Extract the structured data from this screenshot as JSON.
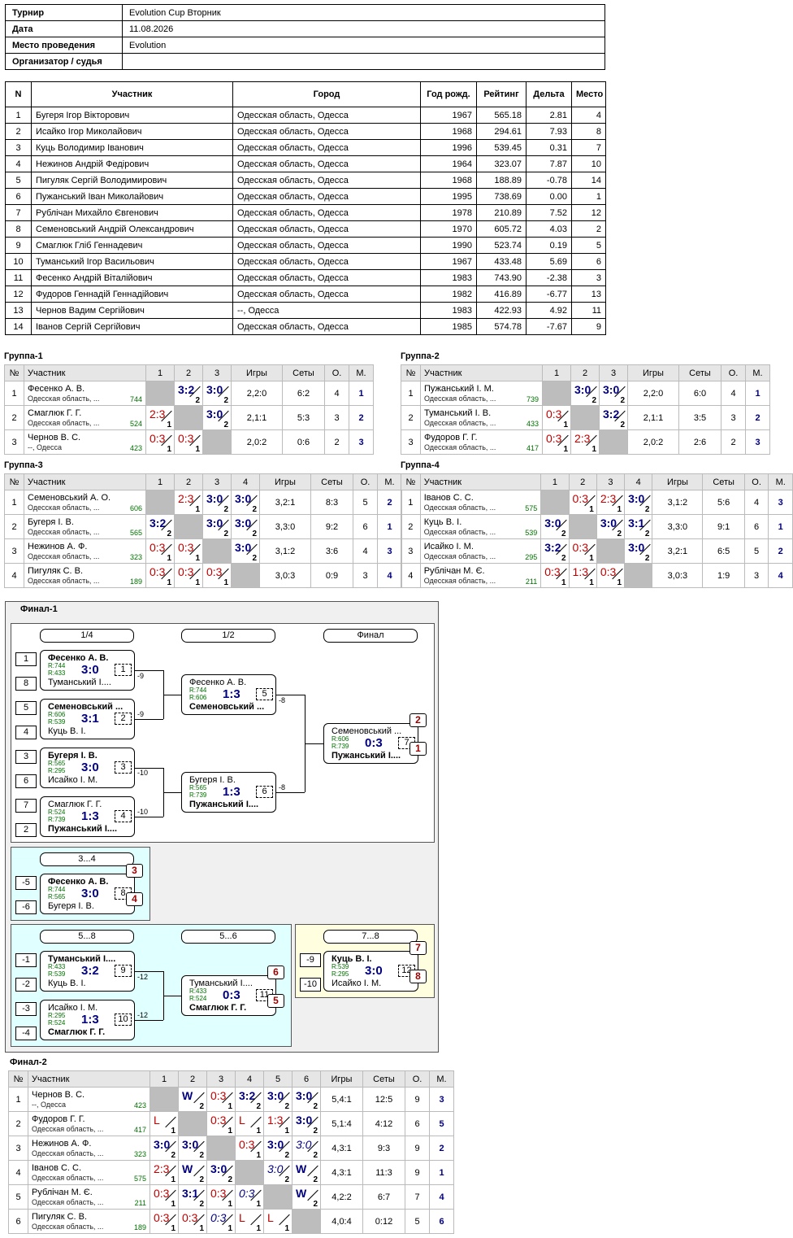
{
  "info": {
    "rows": [
      {
        "label": "Турнир",
        "value": "Evolution Cup Вторник"
      },
      {
        "label": "Дата",
        "value": "11.08.2026"
      },
      {
        "label": "Место проведения",
        "value": "Evolution"
      },
      {
        "label": "Организатор / судья",
        "value": ""
      }
    ]
  },
  "participants": {
    "headers": [
      "N",
      "Участник",
      "Город",
      "Год рожд.",
      "Рейтинг",
      "Дельта",
      "Место"
    ],
    "rows": [
      [
        "1",
        "Бугеря Ігор Вікторович",
        "Одесская область, Одесса",
        "1967",
        "565.18",
        "2.81",
        "4"
      ],
      [
        "2",
        "Исайко Ігор Миколайович",
        "Одесская область, Одесса",
        "1968",
        "294.61",
        "7.93",
        "8"
      ],
      [
        "3",
        "Куць Володимир Іванович",
        "Одесская область, Одесса",
        "1996",
        "539.45",
        "0.31",
        "7"
      ],
      [
        "4",
        "Нежинов Андрій Федірович",
        "Одесская область, Одесса",
        "1964",
        "323.07",
        "7.87",
        "10"
      ],
      [
        "5",
        "Пигуляк Сергій Володимирович",
        "Одесская область, Одесса",
        "1968",
        "188.89",
        "-0.78",
        "14"
      ],
      [
        "6",
        "Пужанський Іван Миколайович",
        "Одесская область, Одесса",
        "1995",
        "738.69",
        "0.00",
        "1"
      ],
      [
        "7",
        "Рублічан Михайло Євгенович",
        "Одесская область, Одесса",
        "1978",
        "210.89",
        "7.52",
        "12"
      ],
      [
        "8",
        "Семеновський Андрій Олександрович",
        "Одесская область, Одесса",
        "1970",
        "605.72",
        "4.03",
        "2"
      ],
      [
        "9",
        "Смаглюк Гліб Геннадевич",
        "Одесская область, Одесса",
        "1990",
        "523.74",
        "0.19",
        "5"
      ],
      [
        "10",
        "Туманський Ігор Васильович",
        "Одесская область, Одесса",
        "1967",
        "433.48",
        "5.69",
        "6"
      ],
      [
        "11",
        "Фесенко Андрій Віталійович",
        "Одесская область, Одесса",
        "1983",
        "743.90",
        "-2.38",
        "3"
      ],
      [
        "12",
        "Фудоров Геннадій Геннадійович",
        "Одесская область, Одесса",
        "1982",
        "416.89",
        "-6.77",
        "13"
      ],
      [
        "13",
        "Чернов Вадим Сергійович",
        "--, Одесса",
        "1983",
        "422.93",
        "4.92",
        "11"
      ],
      [
        "14",
        "Іванов Сергій Сергійович",
        "Одесская область, Одесса",
        "1985",
        "574.78",
        "-7.67",
        "9"
      ]
    ]
  },
  "group_headers": {
    "n": "№",
    "player": "Участник",
    "games": "Игры",
    "sets": "Сеты",
    "points": "О.",
    "place": "М."
  },
  "groups": [
    {
      "title": "Группа-1",
      "rows": [
        {
          "n": "1",
          "name": "Фесенко А. В.",
          "city": "Одесская область, ...",
          "rating": "744",
          "cells": [
            "",
            "3:2|2",
            "3:0|2"
          ],
          "games": "2,2:0",
          "sets": "6:2",
          "points": "4",
          "place": "1"
        },
        {
          "n": "2",
          "name": "Смаглюк Г. Г.",
          "city": "Одесская область, ...",
          "rating": "524",
          "cells": [
            "2:3|1L",
            "",
            "3:0|2"
          ],
          "games": "2,1:1",
          "sets": "5:3",
          "points": "3",
          "place": "2"
        },
        {
          "n": "3",
          "name": "Чернов В. С.",
          "city": "--, Одесса",
          "rating": "423",
          "cells": [
            "0:3|1L",
            "0:3|1L",
            ""
          ],
          "games": "2,0:2",
          "sets": "0:6",
          "points": "2",
          "place": "3"
        }
      ]
    },
    {
      "title": "Группа-2",
      "rows": [
        {
          "n": "1",
          "name": "Пужанський І. М.",
          "city": "Одесская область, ...",
          "rating": "739",
          "cells": [
            "",
            "3:0|2",
            "3:0|2"
          ],
          "games": "2,2:0",
          "sets": "6:0",
          "points": "4",
          "place": "1"
        },
        {
          "n": "2",
          "name": "Туманський І. В.",
          "city": "Одесская область, ...",
          "rating": "433",
          "cells": [
            "0:3|1L",
            "",
            "3:2|2"
          ],
          "games": "2,1:1",
          "sets": "3:5",
          "points": "3",
          "place": "2"
        },
        {
          "n": "3",
          "name": "Фудоров Г. Г.",
          "city": "Одесская область, ...",
          "rating": "417",
          "cells": [
            "0:3|1L",
            "2:3|1L",
            ""
          ],
          "games": "2,0:2",
          "sets": "2:6",
          "points": "2",
          "place": "3"
        }
      ]
    },
    {
      "title": "Группа-3",
      "rows": [
        {
          "n": "1",
          "name": "Семеновський А. О.",
          "city": "Одесская область, ...",
          "rating": "606",
          "cells": [
            "",
            "2:3|1L",
            "3:0|2",
            "3:0|2"
          ],
          "games": "3,2:1",
          "sets": "8:3",
          "points": "5",
          "place": "2"
        },
        {
          "n": "2",
          "name": "Бугеря І. В.",
          "city": "Одесская область, ...",
          "rating": "565",
          "cells": [
            "3:2|2",
            "",
            "3:0|2",
            "3:0|2"
          ],
          "games": "3,3:0",
          "sets": "9:2",
          "points": "6",
          "place": "1"
        },
        {
          "n": "3",
          "name": "Нежинов А. Ф.",
          "city": "Одесская область, ...",
          "rating": "323",
          "cells": [
            "0:3|1L",
            "0:3|1L",
            "",
            "3:0|2"
          ],
          "games": "3,1:2",
          "sets": "3:6",
          "points": "4",
          "place": "3"
        },
        {
          "n": "4",
          "name": "Пигуляк С. В.",
          "city": "Одесская область, ...",
          "rating": "189",
          "cells": [
            "0:3|1L",
            "0:3|1L",
            "0:3|1L",
            ""
          ],
          "games": "3,0:3",
          "sets": "0:9",
          "points": "3",
          "place": "4"
        }
      ]
    },
    {
      "title": "Группа-4",
      "rows": [
        {
          "n": "1",
          "name": "Іванов С. С.",
          "city": "Одесская область, ...",
          "rating": "575",
          "cells": [
            "",
            "0:3|1L",
            "2:3|1L",
            "3:0|2"
          ],
          "games": "3,1:2",
          "sets": "5:6",
          "points": "4",
          "place": "3"
        },
        {
          "n": "2",
          "name": "Куць В. І.",
          "city": "Одесская область, ...",
          "rating": "539",
          "cells": [
            "3:0|2",
            "",
            "3:0|2",
            "3:1|2"
          ],
          "games": "3,3:0",
          "sets": "9:1",
          "points": "6",
          "place": "1"
        },
        {
          "n": "3",
          "name": "Исайко І. М.",
          "city": "Одесская область, ...",
          "rating": "295",
          "cells": [
            "3:2|2",
            "0:3|1L",
            "",
            "3:0|2"
          ],
          "games": "3,2:1",
          "sets": "6:5",
          "points": "5",
          "place": "2"
        },
        {
          "n": "4",
          "name": "Рублічан М. Є.",
          "city": "Одесская область, ...",
          "rating": "211",
          "cells": [
            "0:3|1L",
            "1:3|1L",
            "0:3|1L",
            ""
          ],
          "games": "3,0:3",
          "sets": "1:9",
          "points": "3",
          "place": "4"
        }
      ]
    }
  ],
  "final1": {
    "title": "Финал-1",
    "rounds": [
      "1/4",
      "1/2",
      "Финал",
      "3...4",
      "5...8",
      "5...6",
      "7...8"
    ],
    "seeds": [
      "1",
      "8",
      "5",
      "4",
      "3",
      "6",
      "7",
      "2",
      "-5",
      "-6",
      "-1",
      "-2",
      "-3",
      "-4",
      "-9",
      "-10"
    ],
    "links": [
      "-9",
      "-9",
      "-10",
      "-10",
      "-8",
      "-8",
      "-12",
      "-12"
    ],
    "matches": [
      {
        "a": "Фесенко А. В.",
        "b": "Туманський І....",
        "ra": "R:744",
        "rb": "R:433",
        "score": "3:0",
        "num": "1",
        "win": "a"
      },
      {
        "a": "Семеновський ...",
        "b": "Куць В. І.",
        "ra": "R:606",
        "rb": "R:539",
        "score": "3:1",
        "num": "2",
        "win": "a"
      },
      {
        "a": "Бугеря І. В.",
        "b": "Исайко І. М.",
        "ra": "R:565",
        "rb": "R:295",
        "score": "3:0",
        "num": "3",
        "win": "a"
      },
      {
        "a": "Смаглюк Г. Г.",
        "b": "Пужанський І....",
        "ra": "R:524",
        "rb": "R:739",
        "score": "1:3",
        "num": "4",
        "win": "b"
      },
      {
        "a": "Фесенко А. В.",
        "b": "Семеновський ...",
        "ra": "R:744",
        "rb": "R:606",
        "score": "1:3",
        "num": "5",
        "win": "b"
      },
      {
        "a": "Бугеря І. В.",
        "b": "Пужанський І....",
        "ra": "R:565",
        "rb": "R:739",
        "score": "1:3",
        "num": "6",
        "win": "b"
      },
      {
        "a": "Семеновський ...",
        "b": "Пужанський І....",
        "ra": "R:606",
        "rb": "R:739",
        "score": "0:3",
        "num": "7",
        "win": "b",
        "pa": "2",
        "pb": "1"
      },
      {
        "a": "Фесенко А. В.",
        "b": "Бугеря І. В.",
        "ra": "R:744",
        "rb": "R:565",
        "score": "3:0",
        "num": "8",
        "win": "a",
        "pa": "3",
        "pb": "4"
      },
      {
        "a": "Туманський І....",
        "b": "Куць В. І.",
        "ra": "R:433",
        "rb": "R:539",
        "score": "3:2",
        "num": "9",
        "win": "a"
      },
      {
        "a": "Исайко І. М.",
        "b": "Смаглюк Г. Г.",
        "ra": "R:295",
        "rb": "R:524",
        "score": "1:3",
        "num": "10",
        "win": "b"
      },
      {
        "a": "Туманський І....",
        "b": "Смаглюк Г. Г.",
        "ra": "R:433",
        "rb": "R:524",
        "score": "0:3",
        "num": "11",
        "win": "b",
        "pa": "6",
        "pb": "5"
      },
      {
        "a": "Куць В. І.",
        "b": "Исайко І. М.",
        "ra": "R:539",
        "rb": "R:295",
        "score": "3:0",
        "num": "12",
        "win": "a",
        "pa": "7",
        "pb": "8"
      }
    ]
  },
  "final2": {
    "title": "Финал-2",
    "rows": [
      {
        "n": "1",
        "name": "Чернов В. С.",
        "city": "--, Одесса",
        "rating": "423",
        "cells": [
          "",
          "W|2",
          "0:3|1L",
          "3:2|2",
          "3:0|2",
          "3:0|2"
        ],
        "games": "5,4:1",
        "sets": "12:5",
        "points": "9",
        "place": "3"
      },
      {
        "n": "2",
        "name": "Фудоров Г. Г.",
        "city": "Одесская область, ...",
        "rating": "417",
        "cells": [
          "L|1L",
          "",
          "0:3|1L",
          "L|1L",
          "1:3|1L",
          "3:0|2"
        ],
        "games": "5,1:4",
        "sets": "4:12",
        "points": "6",
        "place": "5"
      },
      {
        "n": "3",
        "name": "Нежинов А. Ф.",
        "city": "Одесская область, ...",
        "rating": "323",
        "cells": [
          "3:0|2",
          "3:0|2",
          "",
          "0:3|1L",
          "3:0|2",
          "3:0|2I"
        ],
        "games": "4,3:1",
        "sets": "9:3",
        "points": "9",
        "place": "2"
      },
      {
        "n": "4",
        "name": "Іванов С. С.",
        "city": "Одесская область, ...",
        "rating": "575",
        "cells": [
          "2:3|1L",
          "W|2",
          "3:0|2",
          "",
          "3:0|2I",
          "W|2"
        ],
        "games": "4,3:1",
        "sets": "11:3",
        "points": "9",
        "place": "1"
      },
      {
        "n": "5",
        "name": "Рублічан М. Є.",
        "city": "Одесская область, ...",
        "rating": "211",
        "cells": [
          "0:3|1L",
          "3:1|2",
          "0:3|1L",
          "0:3|1I",
          "",
          "W|2"
        ],
        "games": "4,2:2",
        "sets": "6:7",
        "points": "7",
        "place": "4"
      },
      {
        "n": "6",
        "name": "Пигуляк С. В.",
        "city": "Одесская область, ...",
        "rating": "189",
        "cells": [
          "0:3|1L",
          "0:3|1L",
          "0:3|1I",
          "L|1L",
          "L|1L",
          ""
        ],
        "games": "4,0:4",
        "sets": "0:12",
        "points": "5",
        "place": "6"
      }
    ]
  }
}
